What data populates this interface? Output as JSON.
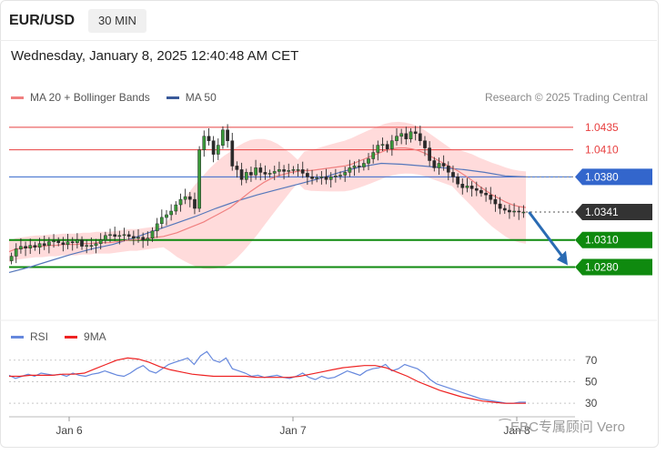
{
  "header": {
    "symbol": "EUR/USD",
    "timeframe": "30 MIN"
  },
  "datetime": "Wednesday, January 8, 2025 12:40:48 AM CET",
  "legend": {
    "ma20": "MA 20 + Bollinger Bands",
    "ma50": "MA 50"
  },
  "credit": "Research © 2025 Trading Central",
  "rsi_legend": {
    "rsi": "RSI",
    "ma9": "9MA"
  },
  "watermark": "⁀EBC专属顾问 Vero",
  "colors": {
    "resistance": "#e84040",
    "pivot": "#3366cc",
    "support": "#0f8a0f",
    "current": "#333333",
    "ma20": "#f08080",
    "ma50": "#5577bb",
    "bollinger": "#ffd5d5",
    "rsi": "#6688dd",
    "ma9": "#ee2222",
    "arrow": "#2a6bb3"
  },
  "chart_data": [
    {
      "type": "candlestick",
      "name": "EUR/USD 30 min",
      "ylim": [
        1.0228,
        1.0455
      ],
      "x_labels": [
        "Jan 6",
        "Jan 7",
        "Jan 8"
      ],
      "levels": [
        {
          "value": 1.0435,
          "label": "1.0435",
          "kind": "resistance"
        },
        {
          "value": 1.041,
          "label": "1.0410",
          "kind": "resistance"
        },
        {
          "value": 1.038,
          "label": "1.0380",
          "kind": "pivot"
        },
        {
          "value": 1.0341,
          "label": "1.0341",
          "kind": "current"
        },
        {
          "value": 1.031,
          "label": "1.0310",
          "kind": "support"
        },
        {
          "value": 1.028,
          "label": "1.0280",
          "kind": "support"
        }
      ],
      "forecast": {
        "from": 1.0341,
        "to": 1.028
      },
      "closes": [
        1.0292,
        1.03,
        1.0303,
        1.0301,
        1.0304,
        1.0302,
        1.0306,
        1.0304,
        1.0308,
        1.0309,
        1.0307,
        1.0305,
        1.0308,
        1.0307,
        1.031,
        1.0303,
        1.0304,
        1.0304,
        1.0306,
        1.031,
        1.0315,
        1.0316,
        1.0314,
        1.0315,
        1.0316,
        1.0314,
        1.0312,
        1.0313,
        1.031,
        1.0312,
        1.032,
        1.0328,
        1.0335,
        1.0338,
        1.0342,
        1.0349,
        1.0355,
        1.0358,
        1.0355,
        1.0345,
        1.041,
        1.0425,
        1.042,
        1.0405,
        1.0415,
        1.0432,
        1.042,
        1.0392,
        1.0388,
        1.0377,
        1.0385,
        1.0382,
        1.039,
        1.0385,
        1.0383,
        1.0384,
        1.0386,
        1.0388,
        1.0386,
        1.0387,
        1.0388,
        1.0388,
        1.0384,
        1.038,
        1.0378,
        1.0379,
        1.038,
        1.0377,
        1.038,
        1.0381,
        1.0382,
        1.0385,
        1.039,
        1.0392,
        1.0391,
        1.0395,
        1.04,
        1.0407,
        1.0415,
        1.0416,
        1.0411,
        1.042,
        1.0425,
        1.0428,
        1.0422,
        1.043,
        1.0428,
        1.042,
        1.0412,
        1.0398,
        1.039,
        1.0395,
        1.0392,
        1.0385,
        1.038,
        1.0372,
        1.0368,
        1.037,
        1.0367,
        1.0365,
        1.0362,
        1.036,
        1.0355,
        1.035,
        1.0345,
        1.0343,
        1.0341,
        1.0342,
        1.0341,
        1.0341
      ],
      "ma20": [
        1.0297,
        1.03,
        1.0301,
        1.0302,
        1.0303,
        1.0303,
        1.0304,
        1.0304,
        1.0305,
        1.0305,
        1.0305,
        1.0306,
        1.0306,
        1.0307,
        1.0307,
        1.0307,
        1.0308,
        1.0309,
        1.031,
        1.031,
        1.0311,
        1.0312,
        1.0313,
        1.0314,
        1.0316,
        1.0318,
        1.0321,
        1.0324,
        1.0327,
        1.033,
        1.0334,
        1.0338,
        1.0342,
        1.0346,
        1.0352,
        1.0358,
        1.0364,
        1.0369,
        1.0374,
        1.0378,
        1.0381,
        1.0383,
        1.0385,
        1.0386,
        1.0387,
        1.0387,
        1.0388,
        1.0389,
        1.039,
        1.0391,
        1.0392,
        1.0394,
        1.0397,
        1.04,
        1.0403,
        1.0406,
        1.0409,
        1.0411,
        1.0412,
        1.0412,
        1.0411,
        1.0409,
        1.0406,
        1.0402,
        1.0398,
        1.0394,
        1.039,
        1.0386,
        1.0381,
        1.0376,
        1.037,
        1.0365,
        1.036,
        1.0356,
        1.0352,
        1.0349,
        1.0347,
        1.0346
      ],
      "ma50": [
        1.0274,
        1.028,
        1.0287,
        1.0294,
        1.03,
        1.0305,
        1.0312,
        1.032,
        1.0328,
        1.0336,
        1.0345,
        1.0353,
        1.036,
        1.0366,
        1.0372,
        1.0378,
        1.0385,
        1.0391,
        1.0395,
        1.0394,
        1.0392,
        1.039,
        1.0388,
        1.0385,
        1.0381,
        1.038
      ]
    },
    {
      "type": "line",
      "name": "RSI",
      "ylim": [
        20,
        85
      ],
      "y_ticks": [
        70,
        50,
        30
      ],
      "series": [
        {
          "name": "RSI",
          "values": [
            56,
            53,
            55,
            57,
            55,
            58,
            57,
            56,
            57,
            55,
            58,
            56,
            55,
            57,
            58,
            60,
            58,
            56,
            55,
            58,
            62,
            65,
            60,
            58,
            62,
            66,
            68,
            70,
            72,
            66,
            74,
            78,
            70,
            68,
            72,
            62,
            60,
            58,
            55,
            56,
            54,
            55,
            56,
            54,
            53,
            55,
            58,
            54,
            52,
            55,
            53,
            54,
            57,
            60,
            58,
            56,
            60,
            62,
            63,
            66,
            60,
            62,
            66,
            64,
            62,
            58,
            52,
            48,
            46,
            44,
            42,
            40,
            38,
            36,
            34,
            33,
            32,
            31,
            30,
            30,
            31,
            31
          ]
        },
        {
          "name": "9MA",
          "values": [
            55,
            55,
            56,
            56,
            56,
            57,
            57,
            58,
            62,
            66,
            70,
            72,
            71,
            68,
            64,
            61,
            59,
            57,
            56,
            55,
            55,
            55,
            55,
            54,
            54,
            54,
            54,
            55,
            57,
            59,
            61,
            63,
            64,
            65,
            65,
            63,
            59,
            55,
            50,
            46,
            42,
            39,
            36,
            34,
            32,
            31,
            30,
            30,
            30
          ]
        }
      ]
    }
  ]
}
